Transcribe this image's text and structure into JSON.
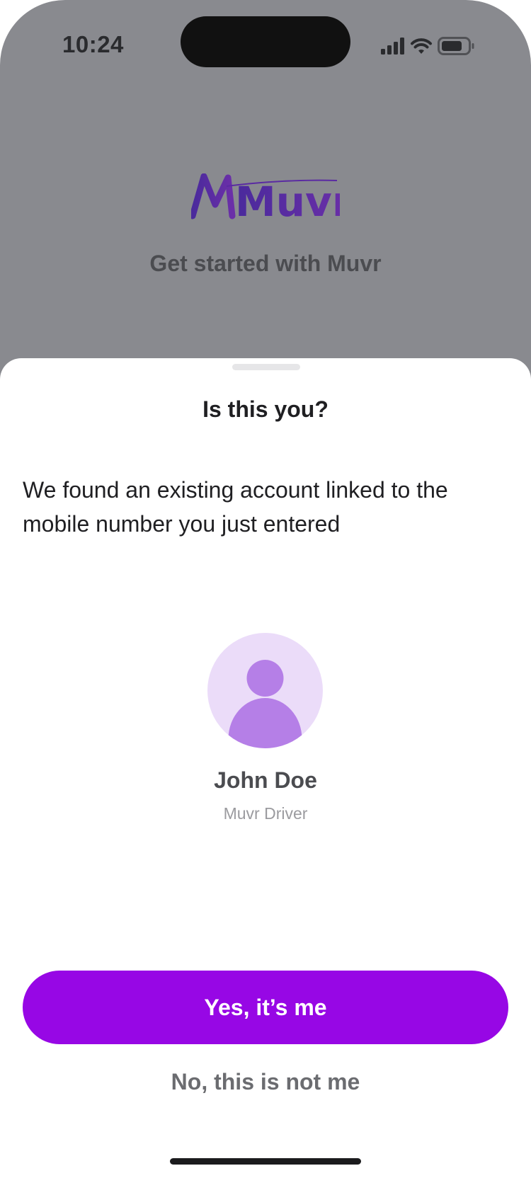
{
  "status_bar": {
    "time": "10:24",
    "icons": [
      "signal-icon",
      "wifi-icon",
      "battery-icon"
    ]
  },
  "background": {
    "logo_text": "Muvr",
    "subtitle": "Get started with Muvr"
  },
  "sheet": {
    "title": "Is this you?",
    "message": "We found an existing account linked to the mobile number you just entered",
    "user": {
      "avatar_icon": "person-icon",
      "name": "John Doe",
      "role": "Muvr Driver"
    },
    "primary_button": "Yes, it’s me",
    "secondary_button": "No, this is not me"
  },
  "colors": {
    "accent": "#9707e5",
    "backdrop": "#898a8f",
    "avatar_bg": "#ebdcf9",
    "avatar_fg": "#b57fe7",
    "logo": "#5e2aa6"
  }
}
